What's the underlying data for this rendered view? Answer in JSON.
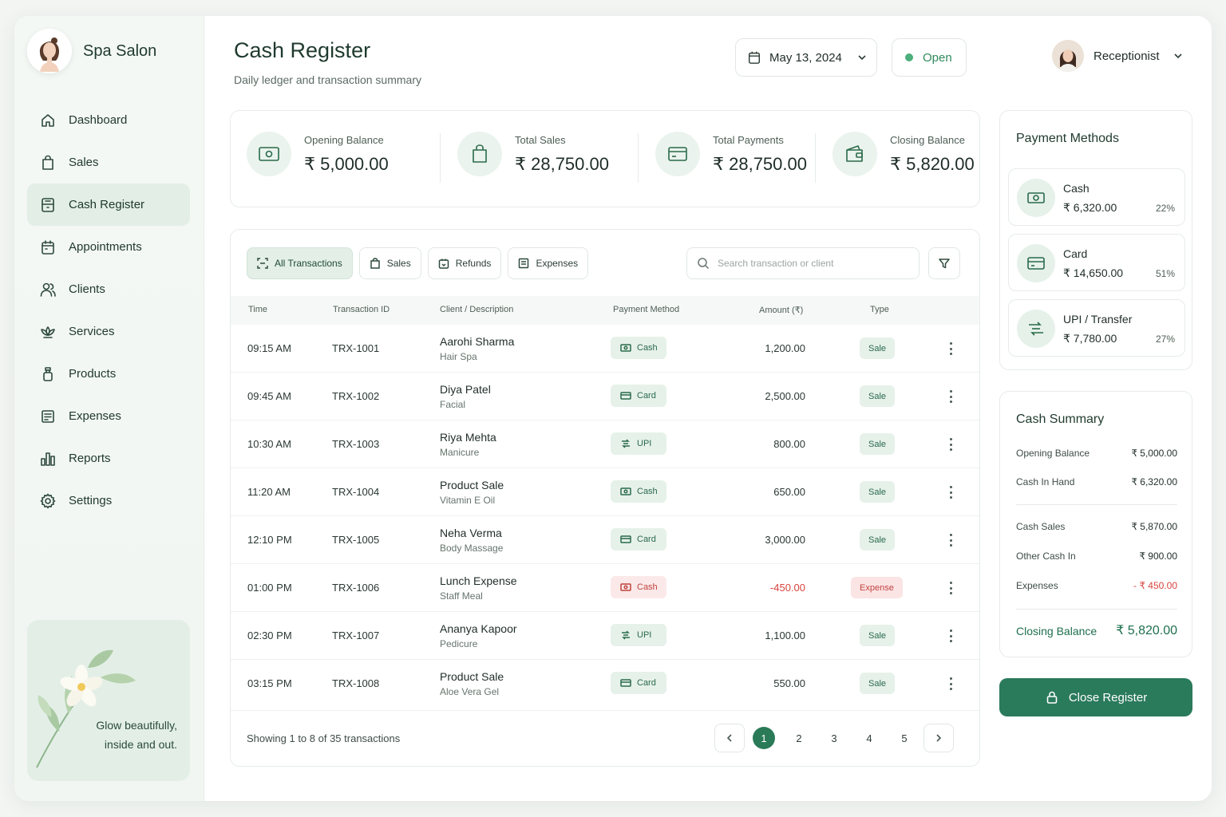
{
  "brand": {
    "name": "Spa Salon"
  },
  "nav": [
    {
      "label": "Dashboard",
      "icon": "home-icon"
    },
    {
      "label": "Sales",
      "icon": "bag-icon"
    },
    {
      "label": "Cash Register",
      "icon": "register-icon",
      "active": true
    },
    {
      "label": "Appointments",
      "icon": "calendar-icon"
    },
    {
      "label": "Clients",
      "icon": "users-icon"
    },
    {
      "label": "Services",
      "icon": "lotus-icon"
    },
    {
      "label": "Products",
      "icon": "bottle-icon"
    },
    {
      "label": "Expenses",
      "icon": "receipt-icon"
    },
    {
      "label": "Reports",
      "icon": "chart-icon"
    },
    {
      "label": "Settings",
      "icon": "gear-icon"
    }
  ],
  "promo": {
    "line1": "Glow beautifully,",
    "line2": "inside and out."
  },
  "header": {
    "title": "Cash Register",
    "subtitle": "Daily ledger and transaction summary",
    "date": "May 13, 2024",
    "status": "Open",
    "user": "Receptionist"
  },
  "summary": {
    "opening": {
      "label": "Opening Balance",
      "value": "₹ 5,000.00"
    },
    "sales": {
      "label": "Total Sales",
      "value": "₹ 28,750.00"
    },
    "payments": {
      "label": "Total Payments",
      "value": "₹ 28,750.00"
    },
    "closing": {
      "label": "Closing Balance",
      "value": "₹ 5,820.00"
    }
  },
  "filters": {
    "all": "All Transactions",
    "sales": "Sales",
    "refunds": "Refunds",
    "expenses": "Expenses",
    "search_placeholder": "Search transaction or client"
  },
  "table": {
    "headers": {
      "time": "Time",
      "id": "Transaction ID",
      "client": "Client / Description",
      "method": "Payment Method",
      "amount": "Amount (₹)",
      "type": "Type"
    },
    "rows": [
      {
        "time": "09:15 AM",
        "id": "TRX-1001",
        "name": "Aarohi Sharma",
        "desc": "Hair Spa",
        "method": "Cash",
        "amount": "1,200.00",
        "type": "Sale"
      },
      {
        "time": "09:45 AM",
        "id": "TRX-1002",
        "name": "Diya Patel",
        "desc": "Facial",
        "method": "Card",
        "amount": "2,500.00",
        "type": "Sale"
      },
      {
        "time": "10:30 AM",
        "id": "TRX-1003",
        "name": "Riya Mehta",
        "desc": "Manicure",
        "method": "UPI",
        "amount": "800.00",
        "type": "Sale"
      },
      {
        "time": "11:20 AM",
        "id": "TRX-1004",
        "name": "Product Sale",
        "desc": "Vitamin E Oil",
        "method": "Cash",
        "amount": "650.00",
        "type": "Sale"
      },
      {
        "time": "12:10 PM",
        "id": "TRX-1005",
        "name": "Neha Verma",
        "desc": "Body Massage",
        "method": "Card",
        "amount": "3,000.00",
        "type": "Sale"
      },
      {
        "time": "01:00 PM",
        "id": "TRX-1006",
        "name": "Lunch Expense",
        "desc": "Staff Meal",
        "method": "Cash",
        "amount": "-450.00",
        "type": "Expense"
      },
      {
        "time": "02:30 PM",
        "id": "TRX-1007",
        "name": "Ananya Kapoor",
        "desc": "Pedicure",
        "method": "UPI",
        "amount": "1,100.00",
        "type": "Sale"
      },
      {
        "time": "03:15 PM",
        "id": "TRX-1008",
        "name": "Product Sale",
        "desc": "Aloe Vera Gel",
        "method": "Card",
        "amount": "550.00",
        "type": "Sale"
      }
    ]
  },
  "pager": {
    "info": "Showing 1 to 8 of 35 transactions",
    "pages": [
      "1",
      "2",
      "3",
      "4",
      "5"
    ]
  },
  "payment_methods": {
    "title": "Payment Methods",
    "items": [
      {
        "name": "Cash",
        "value": "₹ 6,320.00",
        "pct": "22%"
      },
      {
        "name": "Card",
        "value": "₹ 14,650.00",
        "pct": "51%"
      },
      {
        "name": "UPI / Transfer",
        "value": "₹ 7,780.00",
        "pct": "27%"
      }
    ]
  },
  "cash_summary": {
    "title": "Cash Summary",
    "opening": {
      "label": "Opening Balance",
      "value": "₹ 5,000.00"
    },
    "in_hand": {
      "label": "Cash In Hand",
      "value": "₹ 6,320.00"
    },
    "cash_sales": {
      "label": "Cash Sales",
      "value": "₹ 5,870.00"
    },
    "other_in": {
      "label": "Other Cash In",
      "value": "₹ 900.00"
    },
    "expenses": {
      "label": "Expenses",
      "value": "- ₹ 450.00"
    },
    "closing": {
      "label": "Closing Balance",
      "value": "₹ 5,820.00"
    }
  },
  "actions": {
    "close_register": "Close Register"
  },
  "colors": {
    "accent": "#2a7a5c",
    "accent_light": "#e6f1ea",
    "danger": "#d9453f"
  }
}
